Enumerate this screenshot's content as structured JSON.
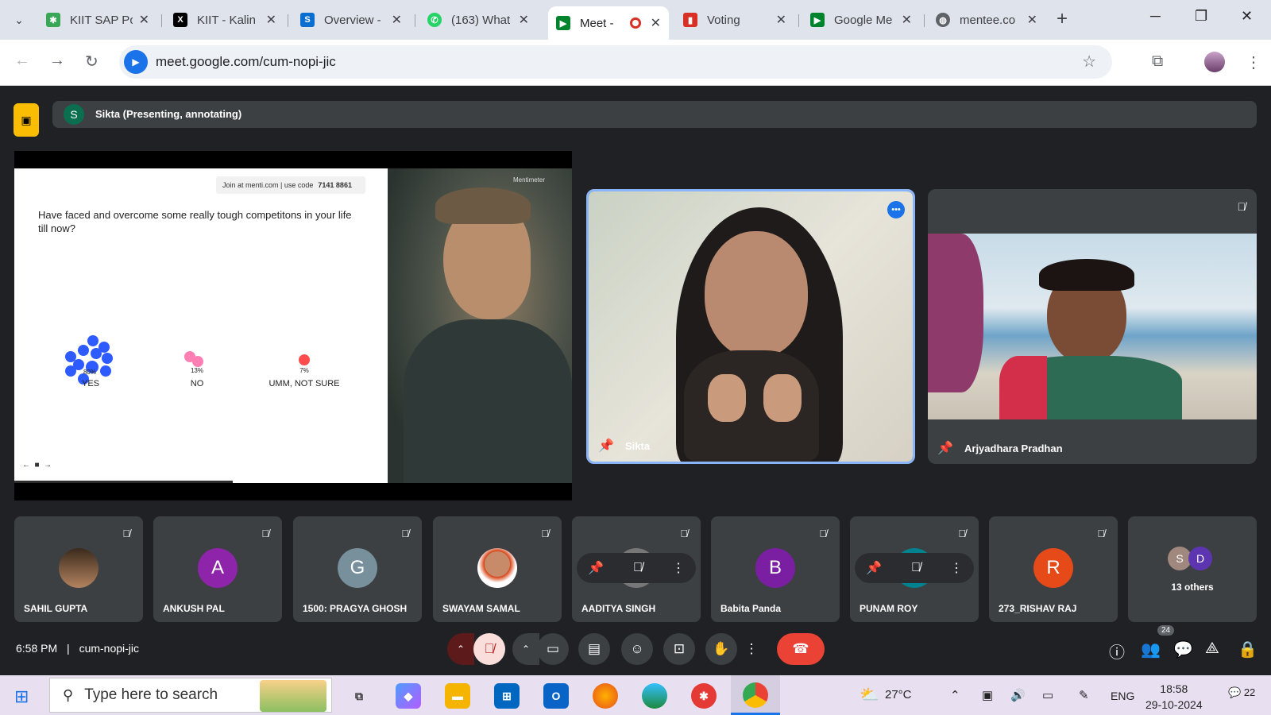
{
  "browser": {
    "tabs": [
      {
        "label": "KIIT SAP Po",
        "icon": "kiit-sap-icon",
        "color": "#3aa757"
      },
      {
        "label": "KIIT - Kalin",
        "icon": "x-icon",
        "color": "#000000"
      },
      {
        "label": "Overview -",
        "icon": "sap-icon",
        "color": "#0a6ed1"
      },
      {
        "label": "(163) What",
        "icon": "whatsapp-icon",
        "color": "#25d366"
      },
      {
        "label": "Meet -",
        "icon": "google-meet-icon",
        "color": "#00832d",
        "active": true
      },
      {
        "label": "Voting",
        "icon": "voting-icon",
        "color": "#d93025"
      },
      {
        "label": "Google Me",
        "icon": "google-meet-icon",
        "color": "#00832d"
      },
      {
        "label": "mentee.co",
        "icon": "globe-icon",
        "color": "#5f6368"
      }
    ],
    "url": "meet.google.com/cum-nopi-jic"
  },
  "meet": {
    "presenter_label": "Sikta (Presenting, annotating)",
    "presenter_initial": "S",
    "slide": {
      "join_text": "Join at menti.com | use code",
      "join_code": "7141 8861",
      "question": "Have faced and overcome some really tough competitons in your life till now?",
      "options": [
        {
          "label": "YES",
          "pct": "80%"
        },
        {
          "label": "NO",
          "pct": "13%"
        },
        {
          "label": "UMM, NOT SURE",
          "pct": "7%"
        }
      ],
      "brand": "Mentimeter"
    },
    "main_tiles": [
      {
        "name": "Sikta"
      },
      {
        "name": "Arjyadhara Pradhan"
      }
    ],
    "participants": [
      {
        "name": "SAHIL GUPTA",
        "initial": "",
        "color": "#a0522d"
      },
      {
        "name": "ANKUSH PAL",
        "initial": "A",
        "color": "#8e24aa"
      },
      {
        "name": "1500: PRAGYA GHOSH",
        "initial": "G",
        "color": "#78909c"
      },
      {
        "name": "SWAYAM SAMAL",
        "initial": "",
        "color": "#d84315"
      },
      {
        "name": "AADITYA SINGH",
        "initial": "",
        "color": "#777777"
      },
      {
        "name": "Babita Panda",
        "initial": "B",
        "color": "#7b1fa2"
      },
      {
        "name": "PUNAM ROY",
        "initial": "R",
        "color": "#00838f"
      },
      {
        "name": "273_RISHAV RAJ",
        "initial": "R",
        "color": "#e64a19"
      }
    ],
    "others": {
      "label": "13 others",
      "a1": "S",
      "a2": "D"
    },
    "time": "6:58 PM",
    "meeting_code": "cum-nopi-jic",
    "people_count": "24"
  },
  "taskbar": {
    "search_placeholder": "Type here to search",
    "weather": "27°C",
    "lang": "ENG",
    "time": "18:58",
    "date": "29-10-2024",
    "notifications": "22"
  }
}
